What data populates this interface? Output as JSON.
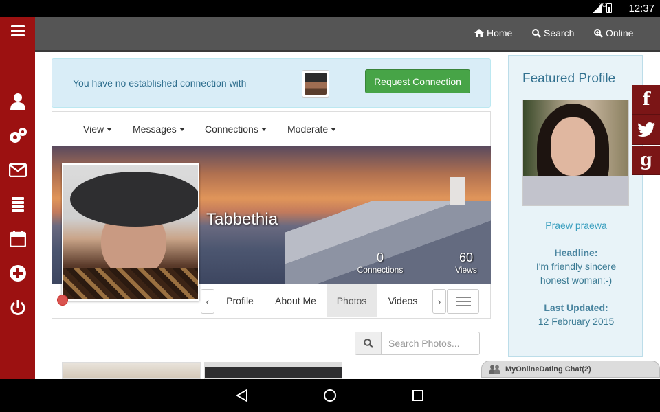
{
  "status_bar": {
    "network": "3G",
    "time": "12:37"
  },
  "sidebar": {
    "items": [
      {
        "icon": "menu-icon"
      },
      {
        "icon": "user-icon"
      },
      {
        "icon": "settings-icon"
      },
      {
        "icon": "envelope-icon"
      },
      {
        "icon": "list-icon"
      },
      {
        "icon": "calendar-icon"
      },
      {
        "icon": "plus-circle-icon"
      },
      {
        "icon": "power-icon"
      }
    ]
  },
  "topnav": {
    "home": "Home",
    "search": "Search",
    "online": "Online"
  },
  "alert": {
    "text": "You have no established connection with",
    "button": "Request Connection"
  },
  "subnav": {
    "view": "View",
    "messages": "Messages",
    "connections": "Connections",
    "moderate": "Moderate"
  },
  "profile": {
    "name": "Tabbethia",
    "connections_count": "0",
    "connections_label": "Connections",
    "views_count": "60",
    "views_label": "Views"
  },
  "tabs": {
    "prev": "‹",
    "profile": "Profile",
    "about": "About Me",
    "photos": "Photos",
    "videos": "Videos",
    "next": "›"
  },
  "photo_search": {
    "placeholder": "Search Photos..."
  },
  "featured": {
    "title": "Featured Profile",
    "name": "Praew praewa",
    "headline_label": "Headline:",
    "headline_line1": "I'm friendly sincere",
    "headline_line2": "honest woman:-)",
    "updated_label": "Last Updated:",
    "updated_value": "12 February 2015"
  },
  "social": {
    "facebook": "f",
    "twitter": "t",
    "google": "g"
  },
  "chat": {
    "label": "MyOnlineDating Chat(2)"
  },
  "colors": {
    "sidebar": "#9c1111",
    "topnav": "#555555",
    "accent_button": "#47a447",
    "alert_bg": "#d9edf7",
    "featured_bg": "#e8f3f8",
    "social_bg": "#7b1516"
  }
}
